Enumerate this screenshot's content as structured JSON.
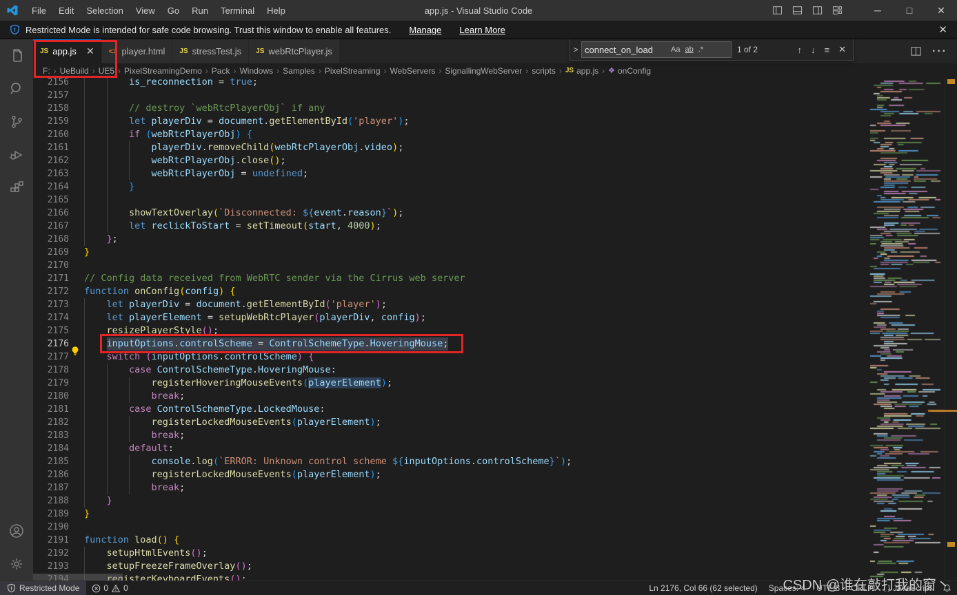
{
  "window": {
    "title": "app.js - Visual Studio Code",
    "menus": [
      "File",
      "Edit",
      "Selection",
      "View",
      "Go",
      "Run",
      "Terminal",
      "Help"
    ],
    "controls": {
      "minimize": "─",
      "maximize": "□",
      "close": "✕"
    }
  },
  "banner": {
    "text": "Restricted Mode is intended for safe code browsing. Trust this window to enable all features.",
    "manage_label": "Manage",
    "learn_more_label": "Learn More",
    "close": "✕"
  },
  "tabs": [
    {
      "label": "app.js",
      "icon": "js",
      "active": true,
      "close": "✕"
    },
    {
      "label": "player.html",
      "icon": "html",
      "active": false
    },
    {
      "label": "stressTest.js",
      "icon": "js",
      "active": false
    },
    {
      "label": "webRtcPlayer.js",
      "icon": "js",
      "active": false
    }
  ],
  "breadcrumb": [
    {
      "label": "F:"
    },
    {
      "label": "UeBuild"
    },
    {
      "label": "UE5"
    },
    {
      "label": "PixelStreamingDemo"
    },
    {
      "label": "Pack"
    },
    {
      "label": "Windows"
    },
    {
      "label": "Samples"
    },
    {
      "label": "PixelStreaming"
    },
    {
      "label": "WebServers"
    },
    {
      "label": "SignallingWebServer"
    },
    {
      "label": "scripts"
    },
    {
      "label": "app.js",
      "icon": "js"
    },
    {
      "label": "onConfig",
      "icon": "symbol"
    }
  ],
  "find": {
    "query": "connect_on_load",
    "results": "1 of 2",
    "options": {
      "match_case": "Aa",
      "whole_word": "ab",
      "regex": ".*"
    },
    "nav": {
      "prev": "↑",
      "next": "↓",
      "in_selection": "≡",
      "close": "✕"
    }
  },
  "palette": {
    "k": "#569CD6",
    "c": "#C586C0",
    "f": "#DCDCAA",
    "v": "#9CDCFE",
    "vh": "#9CDCFE",
    "s": "#CE9178",
    "m": "#6A9955",
    "n": "#B5CEA8",
    "p": "#D4D4D4",
    "d": "#569CD6",
    "b1": "#FFD700",
    "b2": "#DA70D6",
    "b3": "#179FFF",
    "accent": "#0078d4",
    "annotation": "#e22525",
    "selection": "#3a3f4b"
  },
  "code": {
    "lines": [
      {
        "n": 2156,
        "i": 8,
        "t": [
          [
            "v",
            "is_reconnection"
          ],
          [
            "p",
            " = "
          ],
          [
            "k",
            "true"
          ],
          [
            "p",
            ";"
          ]
        ]
      },
      {
        "n": 2157,
        "i": 8,
        "t": []
      },
      {
        "n": 2158,
        "i": 8,
        "t": [
          [
            "m",
            "// destroy `webRtcPlayerObj` if any"
          ]
        ]
      },
      {
        "n": 2159,
        "i": 8,
        "t": [
          [
            "k",
            "let "
          ],
          [
            "v",
            "playerDiv"
          ],
          [
            "p",
            " = "
          ],
          [
            "v",
            "document"
          ],
          [
            "p",
            "."
          ],
          [
            "f",
            "getElementById"
          ],
          [
            "b3",
            "("
          ],
          [
            "s",
            "'player'"
          ],
          [
            "b3",
            ")"
          ],
          [
            "p",
            ";"
          ]
        ]
      },
      {
        "n": 2160,
        "i": 8,
        "t": [
          [
            "c",
            "if "
          ],
          [
            "b3",
            "("
          ],
          [
            "v",
            "webRtcPlayerObj"
          ],
          [
            "b3",
            ")"
          ],
          [
            "p",
            " "
          ],
          [
            "b3",
            "{"
          ]
        ]
      },
      {
        "n": 2161,
        "i": 12,
        "t": [
          [
            "v",
            "playerDiv"
          ],
          [
            "p",
            "."
          ],
          [
            "f",
            "removeChild"
          ],
          [
            "b1",
            "("
          ],
          [
            "v",
            "webRtcPlayerObj"
          ],
          [
            "p",
            "."
          ],
          [
            "v",
            "video"
          ],
          [
            "b1",
            ")"
          ],
          [
            "p",
            ";"
          ]
        ]
      },
      {
        "n": 2162,
        "i": 12,
        "t": [
          [
            "v",
            "webRtcPlayerObj"
          ],
          [
            "p",
            "."
          ],
          [
            "f",
            "close"
          ],
          [
            "b1",
            "()"
          ],
          [
            "p",
            ";"
          ]
        ]
      },
      {
        "n": 2163,
        "i": 12,
        "t": [
          [
            "v",
            "webRtcPlayerObj"
          ],
          [
            "p",
            " = "
          ],
          [
            "k",
            "undefined"
          ],
          [
            "p",
            ";"
          ]
        ]
      },
      {
        "n": 2164,
        "i": 8,
        "t": [
          [
            "b3",
            "}"
          ]
        ]
      },
      {
        "n": 2165,
        "i": 8,
        "t": []
      },
      {
        "n": 2166,
        "i": 8,
        "t": [
          [
            "f",
            "showTextOverlay"
          ],
          [
            "b1",
            "("
          ],
          [
            "s",
            "`Disconnected: "
          ],
          [
            "d",
            "${"
          ],
          [
            "v",
            "event"
          ],
          [
            "p",
            "."
          ],
          [
            "v",
            "reason"
          ],
          [
            "d",
            "}"
          ],
          [
            "s",
            "`"
          ],
          [
            "b1",
            ")"
          ],
          [
            "p",
            ";"
          ]
        ]
      },
      {
        "n": 2167,
        "i": 8,
        "t": [
          [
            "k",
            "let "
          ],
          [
            "v",
            "reclickToStart"
          ],
          [
            "p",
            " = "
          ],
          [
            "f",
            "setTimeout"
          ],
          [
            "b1",
            "("
          ],
          [
            "v",
            "start"
          ],
          [
            "p",
            ", "
          ],
          [
            "n",
            "4000"
          ],
          [
            "b1",
            ")"
          ],
          [
            "p",
            ";"
          ]
        ]
      },
      {
        "n": 2168,
        "i": 4,
        "t": [
          [
            "b2",
            "}"
          ],
          [
            "p",
            ";"
          ]
        ]
      },
      {
        "n": 2169,
        "i": 0,
        "t": [
          [
            "b1",
            "}"
          ]
        ]
      },
      {
        "n": 2170,
        "i": 0,
        "t": []
      },
      {
        "n": 2171,
        "i": 0,
        "t": [
          [
            "m",
            "// Config data received from WebRTC sender via the Cirrus web server"
          ]
        ]
      },
      {
        "n": 2172,
        "i": 0,
        "t": [
          [
            "k",
            "function "
          ],
          [
            "f",
            "onConfig"
          ],
          [
            "b1",
            "("
          ],
          [
            "v",
            "config"
          ],
          [
            "b1",
            ")"
          ],
          [
            "p",
            " "
          ],
          [
            "b1",
            "{"
          ]
        ]
      },
      {
        "n": 2173,
        "i": 4,
        "t": [
          [
            "k",
            "let "
          ],
          [
            "v",
            "playerDiv"
          ],
          [
            "p",
            " = "
          ],
          [
            "v",
            "document"
          ],
          [
            "p",
            "."
          ],
          [
            "f",
            "getElementById"
          ],
          [
            "b2",
            "("
          ],
          [
            "s",
            "'player'"
          ],
          [
            "b2",
            ")"
          ],
          [
            "p",
            ";"
          ]
        ]
      },
      {
        "n": 2174,
        "i": 4,
        "t": [
          [
            "k",
            "let "
          ],
          [
            "v",
            "playerElement"
          ],
          [
            "p",
            " = "
          ],
          [
            "f",
            "setupWebRtcPlayer"
          ],
          [
            "b2",
            "("
          ],
          [
            "v",
            "playerDiv"
          ],
          [
            "p",
            ", "
          ],
          [
            "v",
            "config"
          ],
          [
            "b2",
            ")"
          ],
          [
            "p",
            ";"
          ]
        ]
      },
      {
        "n": 2175,
        "i": 4,
        "t": [
          [
            "f",
            "resizePlayerStyle"
          ],
          [
            "b2",
            "()"
          ],
          [
            "p",
            ";"
          ]
        ]
      },
      {
        "n": 2176,
        "i": 4,
        "sel": true,
        "bulb": true,
        "t": [
          [
            "v",
            "inputOptions"
          ],
          [
            "p",
            "."
          ],
          [
            "v",
            "controlScheme"
          ],
          [
            "p",
            " = "
          ],
          [
            "v",
            "ControlSchemeType"
          ],
          [
            "p",
            "."
          ],
          [
            "v",
            "HoveringMouse"
          ],
          [
            "p",
            ";"
          ]
        ]
      },
      {
        "n": 2177,
        "i": 4,
        "t": [
          [
            "c",
            "switch "
          ],
          [
            "b2",
            "("
          ],
          [
            "v",
            "inputOptions"
          ],
          [
            "p",
            "."
          ],
          [
            "v",
            "controlScheme"
          ],
          [
            "b2",
            ")"
          ],
          [
            "p",
            " "
          ],
          [
            "b2",
            "{"
          ]
        ]
      },
      {
        "n": 2178,
        "i": 8,
        "t": [
          [
            "c",
            "case "
          ],
          [
            "v",
            "ControlSchemeType"
          ],
          [
            "p",
            "."
          ],
          [
            "v",
            "HoveringMouse"
          ],
          [
            "p",
            ":"
          ]
        ]
      },
      {
        "n": 2179,
        "i": 12,
        "t": [
          [
            "f",
            "registerHoveringMouseEvents"
          ],
          [
            "b3",
            "("
          ],
          [
            "vh",
            "playerElement"
          ],
          [
            "b3",
            ")"
          ],
          [
            "p",
            ";"
          ]
        ]
      },
      {
        "n": 2180,
        "i": 12,
        "t": [
          [
            "c",
            "break"
          ],
          [
            "p",
            ";"
          ]
        ]
      },
      {
        "n": 2181,
        "i": 8,
        "t": [
          [
            "c",
            "case "
          ],
          [
            "v",
            "ControlSchemeType"
          ],
          [
            "p",
            "."
          ],
          [
            "v",
            "LockedMouse"
          ],
          [
            "p",
            ":"
          ]
        ]
      },
      {
        "n": 2182,
        "i": 12,
        "t": [
          [
            "f",
            "registerLockedMouseEvents"
          ],
          [
            "b3",
            "("
          ],
          [
            "v",
            "playerElement"
          ],
          [
            "b3",
            ")"
          ],
          [
            "p",
            ";"
          ]
        ]
      },
      {
        "n": 2183,
        "i": 12,
        "t": [
          [
            "c",
            "break"
          ],
          [
            "p",
            ";"
          ]
        ]
      },
      {
        "n": 2184,
        "i": 8,
        "t": [
          [
            "c",
            "default"
          ],
          [
            "p",
            ":"
          ]
        ]
      },
      {
        "n": 2185,
        "i": 12,
        "t": [
          [
            "v",
            "console"
          ],
          [
            "p",
            "."
          ],
          [
            "f",
            "log"
          ],
          [
            "b3",
            "("
          ],
          [
            "s",
            "`ERROR: Unknown control scheme "
          ],
          [
            "d",
            "${"
          ],
          [
            "v",
            "inputOptions"
          ],
          [
            "p",
            "."
          ],
          [
            "v",
            "controlScheme"
          ],
          [
            "d",
            "}"
          ],
          [
            "s",
            "`"
          ],
          [
            "b3",
            ")"
          ],
          [
            "p",
            ";"
          ]
        ]
      },
      {
        "n": 2186,
        "i": 12,
        "t": [
          [
            "f",
            "registerLockedMouseEvents"
          ],
          [
            "b3",
            "("
          ],
          [
            "v",
            "playerElement"
          ],
          [
            "b3",
            ")"
          ],
          [
            "p",
            ";"
          ]
        ]
      },
      {
        "n": 2187,
        "i": 12,
        "t": [
          [
            "c",
            "break"
          ],
          [
            "p",
            ";"
          ]
        ]
      },
      {
        "n": 2188,
        "i": 4,
        "t": [
          [
            "b2",
            "}"
          ]
        ]
      },
      {
        "n": 2189,
        "i": 0,
        "t": [
          [
            "b1",
            "}"
          ]
        ]
      },
      {
        "n": 2190,
        "i": 0,
        "t": []
      },
      {
        "n": 2191,
        "i": 0,
        "t": [
          [
            "k",
            "function "
          ],
          [
            "f",
            "load"
          ],
          [
            "b1",
            "()"
          ],
          [
            "p",
            " "
          ],
          [
            "b1",
            "{"
          ]
        ]
      },
      {
        "n": 2192,
        "i": 4,
        "t": [
          [
            "f",
            "setupHtmlEvents"
          ],
          [
            "b2",
            "()"
          ],
          [
            "p",
            ";"
          ]
        ]
      },
      {
        "n": 2193,
        "i": 4,
        "t": [
          [
            "f",
            "setupFreezeFrameOverlay"
          ],
          [
            "b2",
            "()"
          ],
          [
            "p",
            ";"
          ]
        ]
      },
      {
        "n": 2194,
        "i": 4,
        "t": [
          [
            "f",
            "registerKeyboardEvents"
          ],
          [
            "b2",
            "()"
          ],
          [
            "p",
            ";"
          ]
        ]
      }
    ]
  },
  "status_bar": {
    "restricted_label": "Restricted Mode",
    "errors": "0",
    "warnings": "0",
    "cursor": "Ln 2176, Col 66 (62 selected)",
    "indent": "Spaces: 4",
    "encoding": "UTF-8",
    "eol": "CRLF",
    "lang_icon": "{ }",
    "language": "JavaScript"
  },
  "watermark": "CSDN @谁在敲打我的窗丶"
}
